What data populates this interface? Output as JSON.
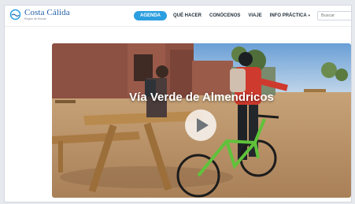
{
  "brand": {
    "name": "Costa Cálida",
    "tagline": "Región de Murcia",
    "logo_icon": "wave-circle-logo",
    "accent": "#1f5fa8"
  },
  "nav": {
    "items": [
      {
        "label": "AGENDA",
        "active": true
      },
      {
        "label": "QUÉ HACER",
        "active": false
      },
      {
        "label": "CONÓCENOS",
        "active": false
      },
      {
        "label": "VIAJE",
        "active": false
      },
      {
        "label": "INFO PRÁCTICA",
        "active": false,
        "has_dropdown": true
      }
    ],
    "active_color": "#2b9fe0"
  },
  "search": {
    "placeholder": "Buscar"
  },
  "video": {
    "title": "Vía Verde de Almendricos",
    "play_icon": "play-icon"
  }
}
